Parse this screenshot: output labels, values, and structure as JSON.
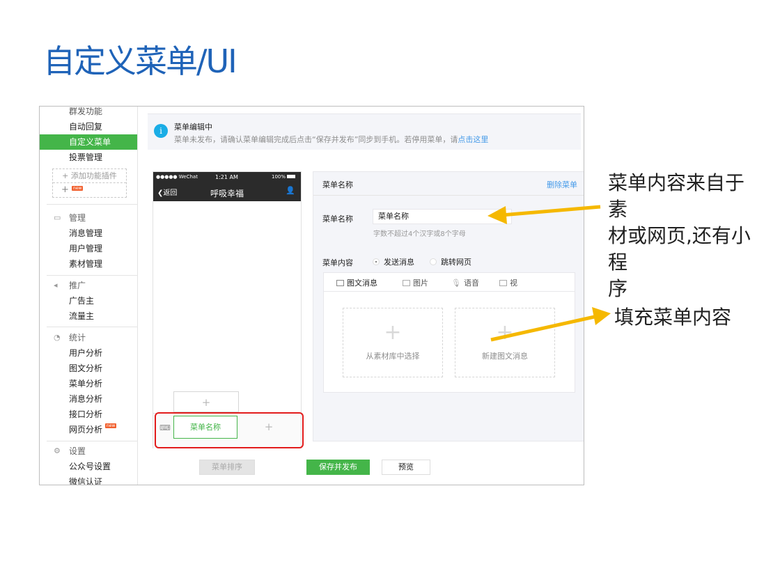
{
  "slide_title": "自定义菜单/UI",
  "sidebar": {
    "top_items": [
      {
        "label": "群发功能"
      },
      {
        "label": "自动回复"
      },
      {
        "label": "自定义菜单"
      },
      {
        "label": "投票管理"
      }
    ],
    "add_plugin_label": "添加功能插件",
    "new_badge": "new",
    "groups": [
      {
        "title": "管理",
        "items": [
          "消息管理",
          "用户管理",
          "素材管理"
        ]
      },
      {
        "title": "推广",
        "items": [
          "广告主",
          "流量主"
        ]
      },
      {
        "title": "统计",
        "items": [
          "用户分析",
          "图文分析",
          "菜单分析",
          "消息分析",
          "接口分析",
          "网页分析"
        ]
      },
      {
        "title": "设置",
        "items": [
          "公众号设置",
          "微信认证"
        ]
      }
    ]
  },
  "notice": {
    "title": "菜单编辑中",
    "text": "菜单未发布，请确认菜单编辑完成后点击“保存并发布”同步到手机。若停用菜单，请",
    "link": "点击这里"
  },
  "phone": {
    "carrier": "●●●●● WeChat",
    "time": "1:21 AM",
    "battery": "100%",
    "back": "返回",
    "title": "呼吸幸福",
    "menu_item": "菜单名称",
    "add_symbol": "+"
  },
  "editor": {
    "header": "菜单名称",
    "delete": "删除菜单",
    "name_label": "菜单名称",
    "name_value": "菜单名称",
    "name_hint": "字数不超过4个汉字或8个字母",
    "content_label": "菜单内容",
    "radio_send": "发送消息",
    "radio_jump": "跳转网页",
    "tabs": [
      "图文消息",
      "图片",
      "语音",
      "视"
    ],
    "pick_library": "从素材库中选择",
    "pick_new": "新建图文消息"
  },
  "footer": {
    "sort": "菜单排序",
    "save": "保存并发布",
    "preview": "预览"
  },
  "annotations": {
    "note1": "菜单内容来自于素材或网页,还有小程序",
    "note1_lines": [
      "菜单内容来自于素",
      "材或网页,还有小程",
      "序"
    ],
    "note2": "填充菜单内容"
  },
  "colors": {
    "title_blue": "#1f63b8",
    "wechat_green": "#44b549",
    "link_blue": "#459ae9",
    "arrow_yellow": "#f5b800",
    "highlight_red": "#e21c1c"
  }
}
